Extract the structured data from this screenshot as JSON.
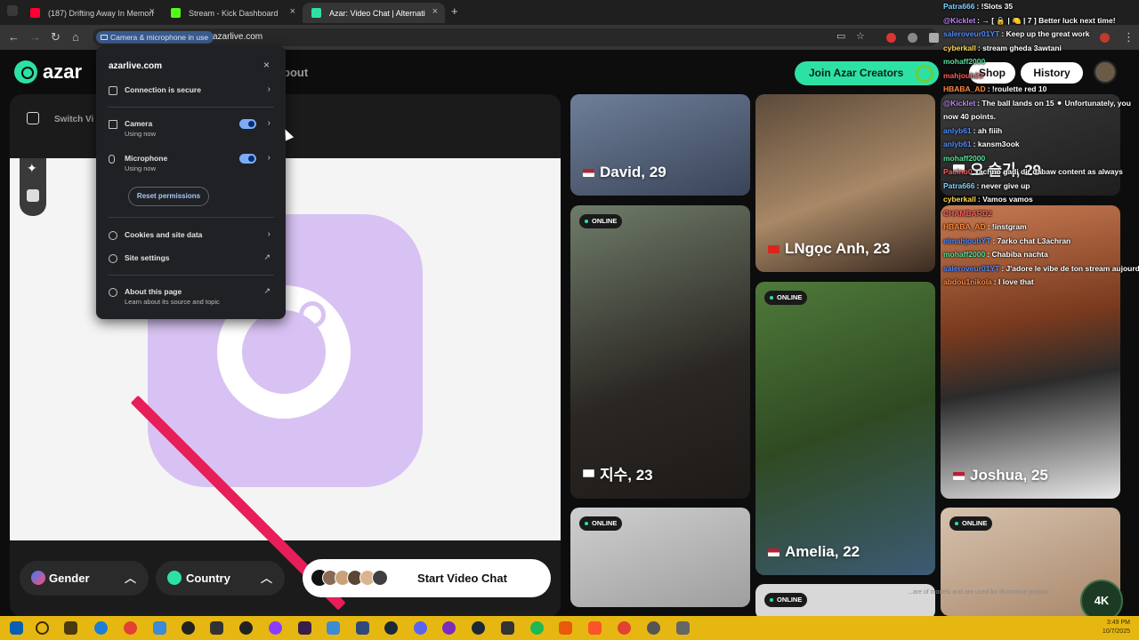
{
  "browser": {
    "tabs": [
      {
        "title": "(187) Drifting Away In Memori",
        "color": "#ff0033"
      },
      {
        "title": "Stream - Kick Dashboard",
        "color": "#53fc18"
      },
      {
        "title": "Azar: Video Chat | Alternati",
        "color": "#2de1a4"
      }
    ],
    "permission_chip": "Camera & microphone in use",
    "url": "azarlive.com"
  },
  "popup": {
    "domain": "azarlive.com",
    "connection": "Connection is secure",
    "camera": {
      "label": "Camera",
      "sub": "Using now"
    },
    "microphone": {
      "label": "Microphone",
      "sub": "Using now"
    },
    "reset": "Reset permissions",
    "cookies": "Cookies and site data",
    "site_settings": "Site settings",
    "about": {
      "label": "About this page",
      "sub": "Learn about its source and topic"
    }
  },
  "azar": {
    "logo": "azar",
    "nav_about": "bout",
    "switch_label": "Switch Vi",
    "creators_button": "Join Azar Creators",
    "shop_button": "Shop",
    "history_button": "History",
    "gender_button": "Gender",
    "country_button": "Country",
    "start_button": "Start Video Chat",
    "online_label": "ONLINE",
    "disclaimer": "...are of models and are used for illustrative purpos"
  },
  "profiles": [
    {
      "name": "David, 29",
      "flag": "us",
      "online": false
    },
    {
      "name": "LNgọc Anh, 23",
      "flag": "vn",
      "online": false
    },
    {
      "name": "지수, 23",
      "flag": "kr",
      "online": true
    },
    {
      "name": "Amelia, 22",
      "flag": "us",
      "online": true
    },
    {
      "name": "Joshua, 25",
      "flag": "us",
      "online": false
    },
    {
      "name": "오 슬기, 29",
      "flag": "kr",
      "online": false
    }
  ],
  "chat": [
    {
      "user": "Patra666",
      "msg": "!Slots 35",
      "color": "#7fd3ff"
    },
    {
      "user": "@Kicklet",
      "msg": "→ [ 🔒 | 🍋 | 7 ] Better luck next time!",
      "color": "#c084fc"
    },
    {
      "user": "saleroveur01YT",
      "msg": "Keep up the great work",
      "color": "#4f8cff"
    },
    {
      "user": "cyberkall",
      "msg": "stream gheda 3awtani",
      "color": "#ffd84d"
    },
    {
      "user": "mohaff2000",
      "msg": "",
      "color": "#57e39b"
    },
    {
      "user": "mahjoub23",
      "msg": "",
      "color": "#ff5a5a"
    },
    {
      "user": "HBABA_AD",
      "msg": "!roulette red 10",
      "color": "#ff8a3d"
    },
    {
      "user": "@Kicklet",
      "msg": "The ball lands on 15 ⚫ Unfortunately, you",
      "color": "#c084fc"
    },
    {
      "user": "",
      "msg": "now 40 points.",
      "color": "#c084fc"
    },
    {
      "user": "anlyb61",
      "msg": "ah fiiih",
      "color": "#4f8cff"
    },
    {
      "user": "anlyb61",
      "msg": "kansm3ook",
      "color": "#4f8cff"
    },
    {
      "user": "mohaff2000",
      "msg": "",
      "color": "#57e39b"
    },
    {
      "user": "Pacino0",
      "msg": "achno gadi dir dabaw content as always",
      "color": "#ff5a5a"
    },
    {
      "user": "Patra666",
      "msg": "never give up",
      "color": "#7fd3ff"
    },
    {
      "user": "cyberkall",
      "msg": "Vamos vamos",
      "color": "#ffd84d"
    },
    {
      "user": "CHAMBARD2",
      "msg": "",
      "color": "#ff5a5a"
    },
    {
      "user": "HBABA_AD",
      "msg": "!instgram",
      "color": "#ff8a3d"
    },
    {
      "user": "elmahjoubYT",
      "msg": "7arko chat L3achran",
      "color": "#4f8cff"
    },
    {
      "user": "mohaff2000",
      "msg": "Chabiba nachta",
      "color": "#57e39b"
    },
    {
      "user": "saleroveur01YT",
      "msg": "J'adore le vibe de ton stream aujourd'hui",
      "color": "#4f8cff"
    },
    {
      "user": "abdou1nikola",
      "msg": "I love that",
      "color": "#ff8a3d"
    }
  ],
  "taskbar": {
    "time": "3:49 PM",
    "date": "10/7/2025",
    "badge": "4K"
  }
}
